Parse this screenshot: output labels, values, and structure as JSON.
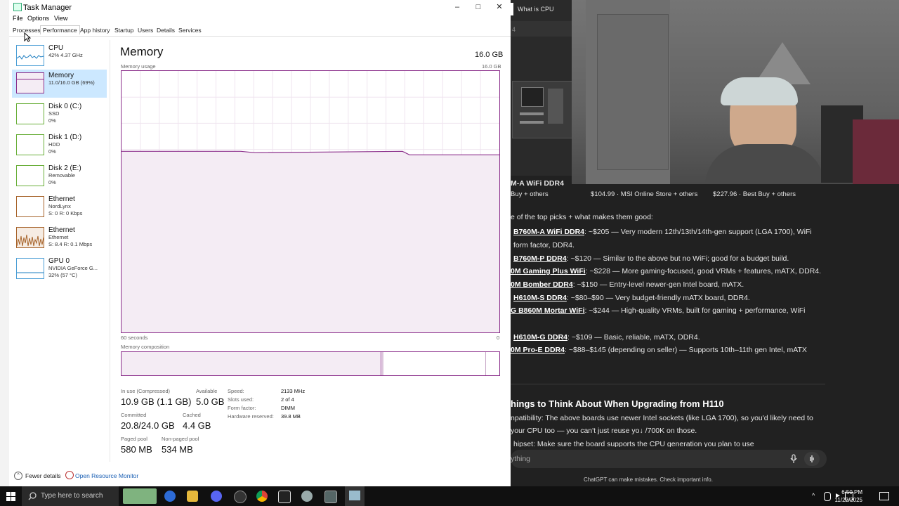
{
  "taskmanager": {
    "title": "Task Manager",
    "minimize": "–",
    "maximize": "□",
    "close": "✕",
    "menu": [
      "File",
      "Options",
      "View"
    ],
    "tabs": [
      "Processes",
      "Performance",
      "App history",
      "Startup",
      "Users",
      "Details",
      "Services"
    ],
    "active_tab": "Performance",
    "sidebar": [
      {
        "name": "CPU",
        "sub1": "42%  4.37 GHz",
        "sub2": ""
      },
      {
        "name": "Memory",
        "sub1": "11.0/16.0 GB (69%)",
        "sub2": ""
      },
      {
        "name": "Disk 0 (C:)",
        "sub1": "SSD",
        "sub2": "0%"
      },
      {
        "name": "Disk 1 (D:)",
        "sub1": "HDD",
        "sub2": "0%"
      },
      {
        "name": "Disk 2 (E:)",
        "sub1": "Removable",
        "sub2": "0%"
      },
      {
        "name": "Ethernet",
        "sub1": "NordLynx",
        "sub2": "S: 0  R: 0 Kbps"
      },
      {
        "name": "Ethernet",
        "sub1": "Ethernet",
        "sub2": "S: 8.4  R: 0.1 Mbps"
      },
      {
        "name": "GPU 0",
        "sub1": "NVIDIA GeForce G...",
        "sub2": "32% (57 °C)"
      }
    ],
    "memory": {
      "title": "Memory",
      "total": "16.0 GB",
      "usage_label": "Memory usage",
      "usage_max": "16.0 GB",
      "time_label": "60 seconds",
      "time_end": "0",
      "composition_label": "Memory composition",
      "in_use_label": "In use (Compressed)",
      "in_use": "10.9 GB (1.1 GB)",
      "available_label": "Available",
      "available": "5.0 GB",
      "committed_label": "Committed",
      "committed": "20.8/24.0 GB",
      "cached_label": "Cached",
      "cached": "4.4 GB",
      "paged_label": "Paged pool",
      "paged": "580 MB",
      "nonpaged_label": "Non-paged pool",
      "nonpaged": "534 MB",
      "speed_label": "Speed:",
      "speed": "2133 MHz",
      "slots_label": "Slots used:",
      "slots": "2 of 4",
      "form_label": "Form factor:",
      "form": "DIMM",
      "hwres_label": "Hardware reserved:",
      "hwres": "39.8 MB",
      "usage_fraction": 0.69
    },
    "footer": {
      "fewer": "Fewer details",
      "monitor": "Open Resource Monitor"
    }
  },
  "chat": {
    "tab_title": "What is CPU",
    "stub": "4",
    "prices": [
      {
        "name": "M-A WiFi DDR4",
        "price": "Buy + others"
      },
      {
        "name": "",
        "price": "$104.99 · MSI Online Store + others"
      },
      {
        "name": "",
        "price": "$227.96 · Best Buy + others"
      }
    ],
    "intro": "e of the top picks + what makes them good:",
    "items": [
      {
        "b": "B760M-A WiFi DDR4",
        "t": ": ~$205 — Very modern 12th/13th/14th-gen support (LGA 1700), WiFi"
      },
      {
        "b": "",
        "t": "form factor, DDR4."
      },
      {
        "b": "B760M-P DDR4",
        "t": ": ~$120 — Similar to the above but no WiFi; good for a budget build."
      },
      {
        "b": "0M Gaming Plus WiFi",
        "t": ": ~$228 — More gaming-focused, good VRMs + features, mATX, DDR4."
      },
      {
        "b": "0M Bomber DDR4",
        "t": ": ~$150 — Entry-level newer-gen Intel board, mATX."
      },
      {
        "b": "H610M-S DDR4",
        "t": ": ~$80–$90 — Very budget-friendly mATX board, DDR4."
      },
      {
        "b": "G B860M Mortar WiFi",
        "t": ": ~$244 — High-quality VRMs, built for gaming + performance, WiFi"
      },
      {
        "b": "H610M-G DDR4",
        "t": ": ~$109 — Basic, reliable, mATX, DDR4."
      },
      {
        "b": "0M Pro-E DDR4",
        "t": ": ~$88–$145 (depending on seller) — Supports 10th–11th gen Intel, mATX"
      }
    ],
    "heading": "hings to Think About When Upgrading from H110",
    "p1": "npatibility: The above boards use newer Intel sockets (like LGA 1700), so you'd likely need to",
    "p2": "your CPU too — you can't just reuse yo↓ /700K on those.",
    "p3": "hipset: Make sure the board supports the CPU generation you plan to use",
    "input_placeholder": "ything",
    "disclaimer": "ChatGPT can make mistakes. Check important info."
  },
  "taskbar": {
    "search": "Type here to search",
    "time": "6:50 PM",
    "date": "11/22/2025"
  }
}
